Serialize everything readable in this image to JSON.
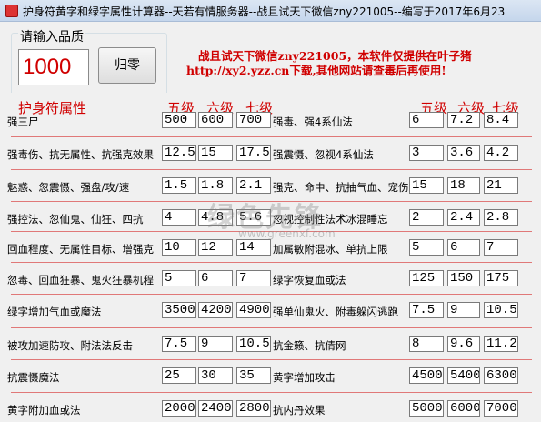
{
  "window": {
    "title": "护身符黄字和绿字属性计算器--天若有情服务器--战且试天下微信zny221005--编写于2017年6月23"
  },
  "input_group": {
    "label": "请输入品质",
    "value": "1000",
    "reset_label": "归零"
  },
  "notice": {
    "line1": "战且试天下微信zny221005，本软件仅提供在叶子猪",
    "line2": "http://xy2.yzz.cn下载,其他网站请查毒后再使用!"
  },
  "headers": {
    "section": "护身符属性",
    "l5": "五级",
    "l6": "六级",
    "l7": "七级",
    "r5": "五级",
    "r6": "六级",
    "r7": "七级"
  },
  "watermark": {
    "main": "绿色先锋",
    "sub": "www.greenxf.com"
  },
  "rows": [
    {
      "left": {
        "label": "强三尸",
        "v5": "500",
        "v6": "600",
        "v7": "700"
      },
      "right": {
        "label": "强毒、强4系仙法",
        "v5": "6",
        "v6": "7.2",
        "v7": "8.4"
      }
    },
    {
      "left": {
        "label": "强毒伤、抗无属性、抗强克效果",
        "v5": "12.5",
        "v6": "15",
        "v7": "17.5"
      },
      "right": {
        "label": "强震慑、忽视4系仙法",
        "v5": "3",
        "v6": "3.6",
        "v7": "4.2"
      }
    },
    {
      "left": {
        "label": "魅惑、忽震慑、强盘/攻/速",
        "v5": "1.5",
        "v6": "1.8",
        "v7": "2.1"
      },
      "right": {
        "label": "强克、命中、抗抽气血、宠伤",
        "v5": "15",
        "v6": "18",
        "v7": "21"
      }
    },
    {
      "left": {
        "label": "强控法、忽仙鬼、仙狂、四抗",
        "v5": "4",
        "v6": "4.8",
        "v7": "5.6"
      },
      "right": {
        "label": "忽视控制性法术冰混睡忘",
        "v5": "2",
        "v6": "2.4",
        "v7": "2.8"
      }
    },
    {
      "left": {
        "label": "回血程度、无属性目标、增强克",
        "v5": "10",
        "v6": "12",
        "v7": "14"
      },
      "right": {
        "label": "加属敏附混冰、单抗上限",
        "v5": "5",
        "v6": "6",
        "v7": "7"
      }
    },
    {
      "left": {
        "label": "忽毒、回血狂暴、鬼火狂暴机程",
        "v5": "5",
        "v6": "6",
        "v7": "7"
      },
      "right": {
        "label": "绿字恢复血或法",
        "v5": "125",
        "v6": "150",
        "v7": "175"
      }
    },
    {
      "left": {
        "label": "绿字增加气血或魔法",
        "v5": "3500",
        "v6": "4200",
        "v7": "4900"
      },
      "right": {
        "label": "强单仙鬼火、附毒躲闪逃跑",
        "v5": "7.5",
        "v6": "9",
        "v7": "10.5"
      }
    },
    {
      "left": {
        "label": "被攻加速防攻、附法法反击",
        "v5": "7.5",
        "v6": "9",
        "v7": "10.5"
      },
      "right": {
        "label": "抗金籁、抗倩网",
        "v5": "8",
        "v6": "9.6",
        "v7": "11.2"
      }
    },
    {
      "left": {
        "label": "抗震慑魔法",
        "v5": "25",
        "v6": "30",
        "v7": "35"
      },
      "right": {
        "label": "黄字增加攻击",
        "v5": "4500",
        "v6": "5400",
        "v7": "6300"
      }
    },
    {
      "left": {
        "label": "黄字附加血或法",
        "v5": "2000",
        "v6": "2400",
        "v7": "2800"
      },
      "right": {
        "label": "抗内丹效果",
        "v5": "5000",
        "v6": "6000",
        "v7": "7000"
      }
    }
  ]
}
